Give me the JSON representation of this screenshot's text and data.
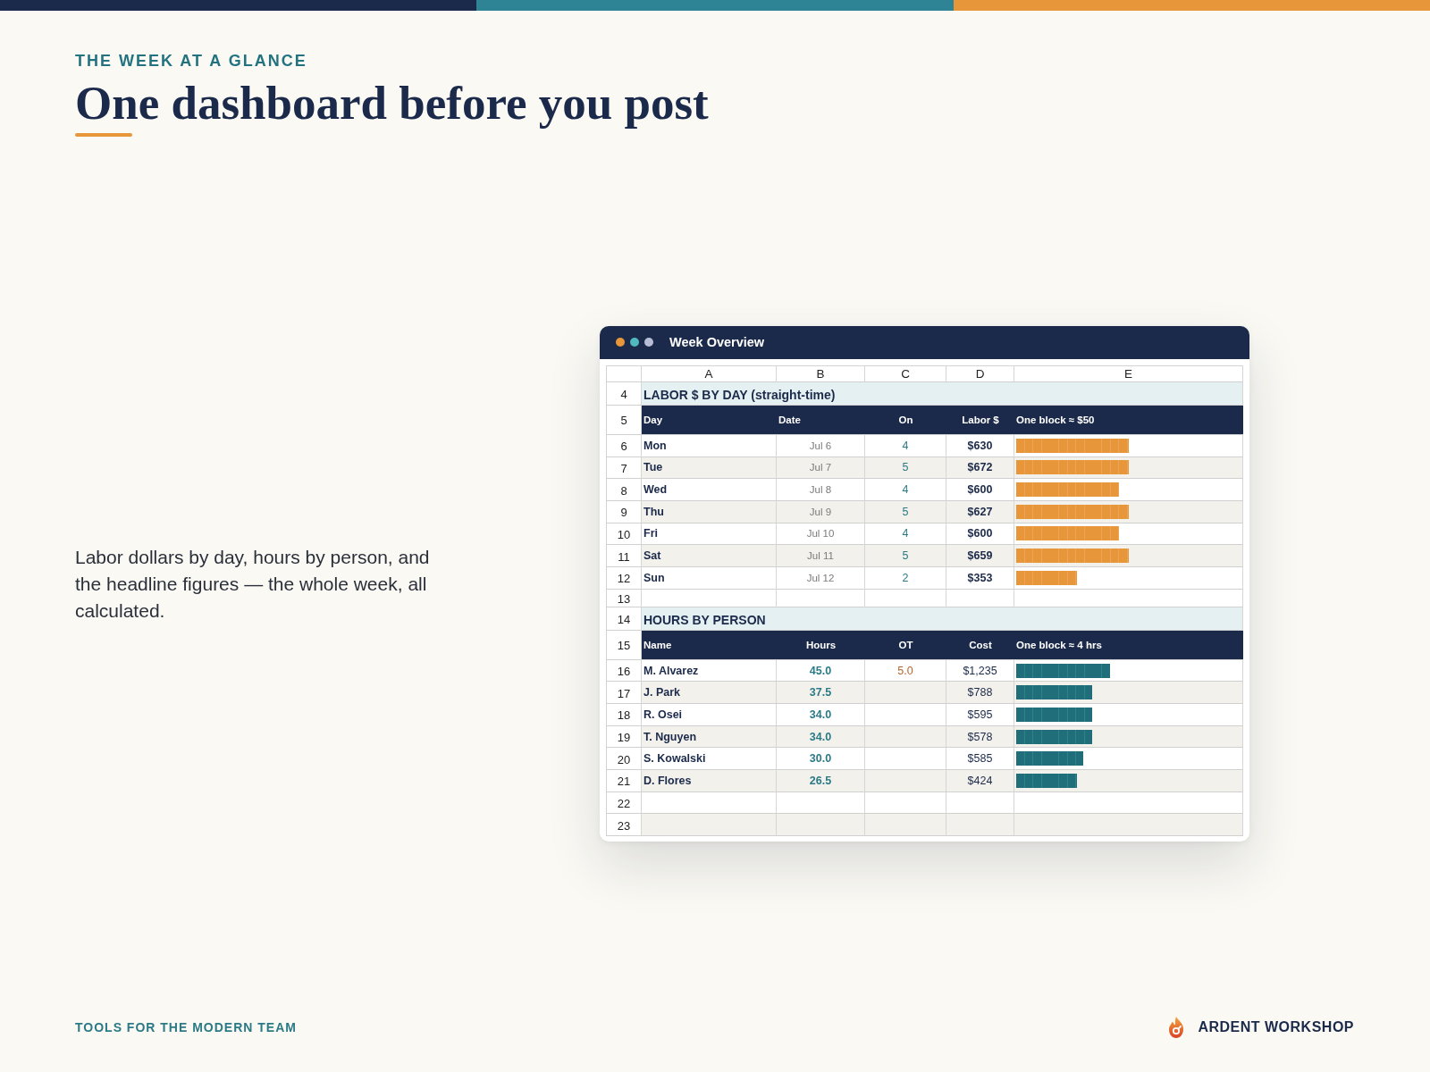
{
  "eyebrow": "THE WEEK AT A GLANCE",
  "title": "One dashboard before you post",
  "description": "Labor dollars by day, hours by person, and the headline figures — the whole week, all calculated.",
  "sheet": {
    "title": "Week Overview",
    "columns": [
      "A",
      "B",
      "C",
      "D",
      "E"
    ],
    "rows": [
      {
        "number": "4",
        "kind": "section",
        "title": "LABOR $ BY DAY (straight-time)"
      },
      {
        "number": "5",
        "kind": "day_header",
        "labels": [
          "Day",
          "Date",
          "On",
          "Labor $",
          "One block ≈ $50"
        ]
      },
      {
        "number": "6",
        "kind": "day",
        "day": "Mon",
        "date": "Jul 6",
        "on": "4",
        "labor": "$630",
        "level": 0.5
      },
      {
        "number": "7",
        "kind": "day",
        "day": "Tue",
        "date": "Jul 7",
        "on": "5",
        "labor": "$672",
        "level": 0.5
      },
      {
        "number": "8",
        "kind": "day",
        "day": "Wed",
        "date": "Jul 8",
        "on": "4",
        "labor": "$600",
        "level": 0.46
      },
      {
        "number": "9",
        "kind": "day",
        "day": "Thu",
        "date": "Jul 9",
        "on": "5",
        "labor": "$627",
        "level": 0.5
      },
      {
        "number": "10",
        "kind": "day",
        "day": "Fri",
        "date": "Jul 10",
        "on": "4",
        "labor": "$600",
        "level": 0.46
      },
      {
        "number": "11",
        "kind": "day",
        "day": "Sat",
        "date": "Jul 11",
        "on": "5",
        "labor": "$659",
        "level": 0.5
      },
      {
        "number": "12",
        "kind": "day",
        "day": "Sun",
        "date": "Jul 12",
        "on": "2",
        "labor": "$353",
        "level": 0.27
      },
      {
        "number": "13",
        "kind": "spacer"
      },
      {
        "number": "14",
        "kind": "section",
        "title": "HOURS BY PERSON"
      },
      {
        "number": "15",
        "kind": "person_header",
        "labels": [
          "Name",
          "Hours",
          "OT",
          "Cost",
          "One block ≈ 4 hrs"
        ]
      },
      {
        "number": "16",
        "kind": "person",
        "name": "M. Alvarez",
        "hours": "45.0",
        "ot": "5.0",
        "cost": "$1,235",
        "level": 0.42
      },
      {
        "number": "17",
        "kind": "person",
        "name": "J. Park",
        "hours": "37.5",
        "cost": "$788",
        "level": 0.34
      },
      {
        "number": "18",
        "kind": "person",
        "name": "R. Osei",
        "hours": "34.0",
        "cost": "$595",
        "level": 0.34
      },
      {
        "number": "19",
        "kind": "person",
        "name": "T. Nguyen",
        "hours": "34.0",
        "cost": "$578",
        "level": 0.34
      },
      {
        "number": "20",
        "kind": "person",
        "name": "S. Kowalski",
        "hours": "30.0",
        "cost": "$585",
        "level": 0.3
      },
      {
        "number": "21",
        "kind": "person",
        "name": "D. Flores",
        "hours": "26.5",
        "cost": "$424",
        "level": 0.27
      },
      {
        "number": "22",
        "kind": "empty"
      },
      {
        "number": "23",
        "kind": "empty"
      }
    ]
  },
  "footer": {
    "tagline": "TOOLS FOR THE MODERN TEAM",
    "brand": "ARDENT WORKSHOP"
  }
}
